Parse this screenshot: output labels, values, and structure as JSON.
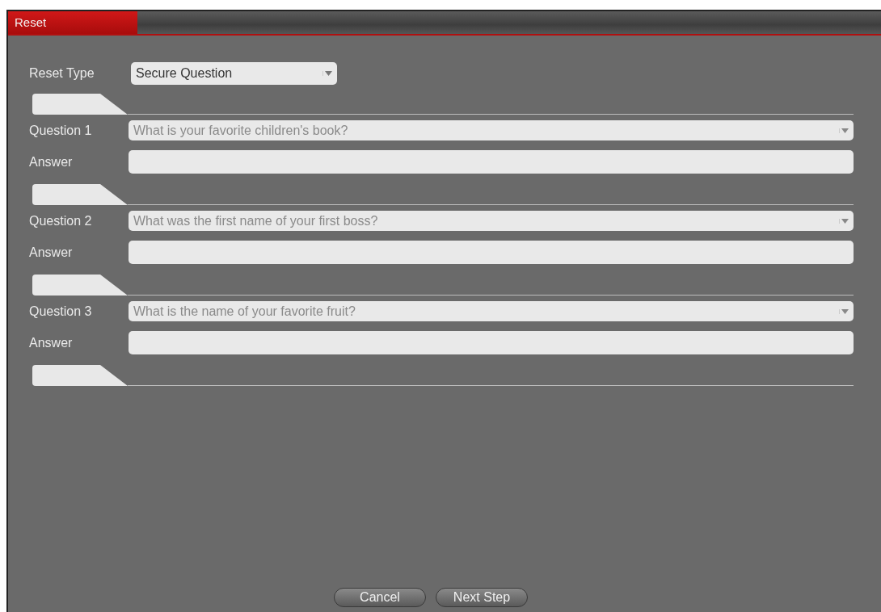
{
  "window": {
    "title": "Reset"
  },
  "reset_type": {
    "label": "Reset Type",
    "value": "Secure Question"
  },
  "questions": [
    {
      "label": "Question 1",
      "question": "What is your favorite children's book?",
      "answer_label": "Answer"
    },
    {
      "label": "Question 2",
      "question": "What was the first name of your first boss?",
      "answer_label": "Answer"
    },
    {
      "label": "Question 3",
      "question": "What is the name of your favorite fruit?",
      "answer_label": "Answer"
    }
  ],
  "buttons": [
    "Cancel",
    "Next Step"
  ]
}
